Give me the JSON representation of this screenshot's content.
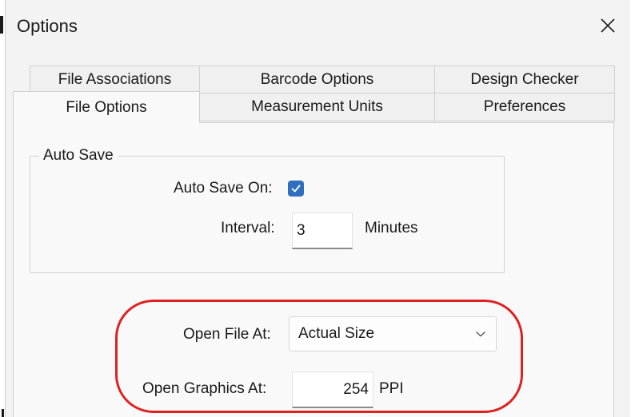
{
  "window": {
    "title": "Options"
  },
  "tabs": {
    "row1": [
      "File Associations",
      "Barcode Options",
      "Design Checker"
    ],
    "row2": [
      "File Options",
      "Measurement Units",
      "Preferences"
    ],
    "active": "File Options"
  },
  "auto_save": {
    "group_label": "Auto Save",
    "auto_save_on_label": "Auto Save On:",
    "auto_save_on_checked": true,
    "interval_label": "Interval:",
    "interval_value": "3",
    "interval_unit": "Minutes"
  },
  "open_settings": {
    "open_file_at_label": "Open File At:",
    "open_file_at_value": "Actual Size",
    "open_graphics_at_label": "Open Graphics At:",
    "open_graphics_at_value": "254",
    "open_graphics_unit": "PPI"
  },
  "colors": {
    "highlight": "#e02020",
    "checkbox": "#2f6fbf"
  }
}
